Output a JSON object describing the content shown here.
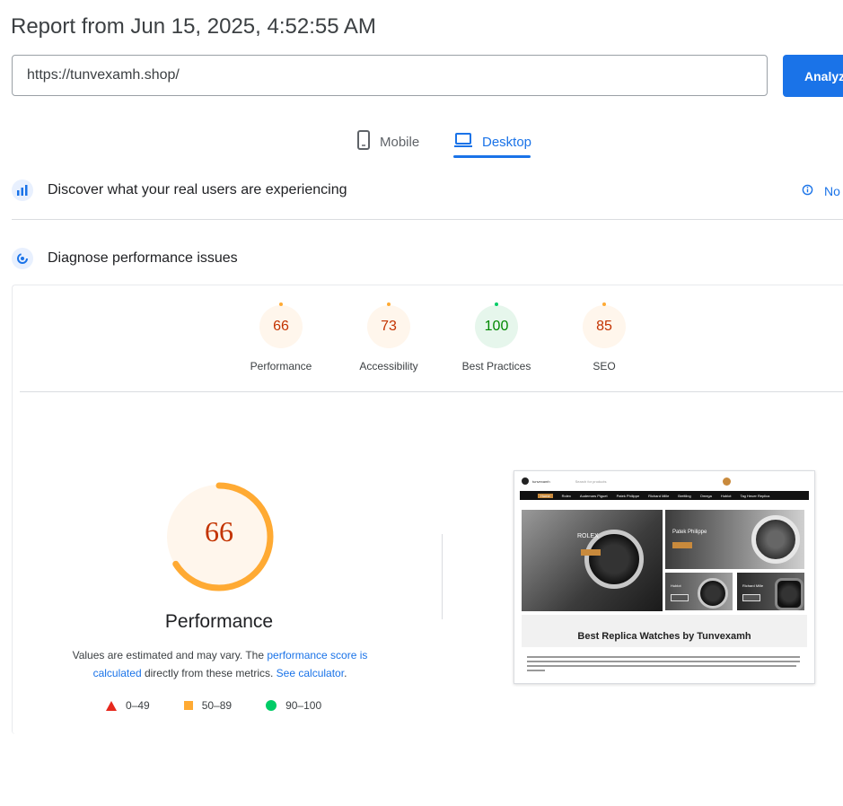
{
  "header": {
    "report_title": "Report from Jun 15, 2025, 4:52:55 AM",
    "url_value": "https://tunvexamh.shop/",
    "analyze_label": "Analyze"
  },
  "tabs": [
    {
      "label": "Mobile",
      "icon": "phone-icon",
      "active": false
    },
    {
      "label": "Desktop",
      "icon": "laptop-icon",
      "active": true
    }
  ],
  "field_data": {
    "heading": "Discover what your real users are experiencing",
    "no_data_label": "No"
  },
  "lab_data": {
    "heading": "Diagnose performance issues"
  },
  "gauges": [
    {
      "value": "66",
      "label": "Performance",
      "status": "average"
    },
    {
      "value": "73",
      "label": "Accessibility",
      "status": "average"
    },
    {
      "value": "100",
      "label": "Best Practices",
      "status": "pass"
    },
    {
      "value": "85",
      "label": "SEO",
      "status": "average"
    }
  ],
  "performance": {
    "score": "66",
    "score_fraction": 0.66,
    "title": "Performance",
    "desc_part1": "Values are estimated and may vary. The ",
    "desc_link1": "performance score is calculated",
    "desc_part2": " directly from these metrics. ",
    "desc_link2": "See calculator",
    "desc_part3": "."
  },
  "legend": [
    {
      "shape": "triangle",
      "range": "0–49",
      "color": "#e6281d"
    },
    {
      "shape": "square",
      "range": "50–89",
      "color": "#ffaa33"
    },
    {
      "shape": "circle",
      "range": "90–100",
      "color": "#00cc66"
    }
  ],
  "screenshot": {
    "site_name": "tunvexamh",
    "search_placeholder": "Search for products",
    "nav_items": [
      "Home",
      "Rolex",
      "Audemars Piguet",
      "Patek Philippe",
      "Richard Mille",
      "Breitling",
      "Omega",
      "Hublot",
      "Tag Heuer Replica"
    ],
    "hero_brand": "ROLEX",
    "panel_1": "Patek Philippe",
    "panel_2": "Hublot",
    "panel_3": "Richard Mille",
    "headline": "Best Replica Watches by Tunvexamh"
  },
  "colors": {
    "accent": "#1a73e8",
    "average": "#ffaa33",
    "average_text": "#c33300",
    "pass": "#00cc66",
    "pass_text": "#008800"
  }
}
